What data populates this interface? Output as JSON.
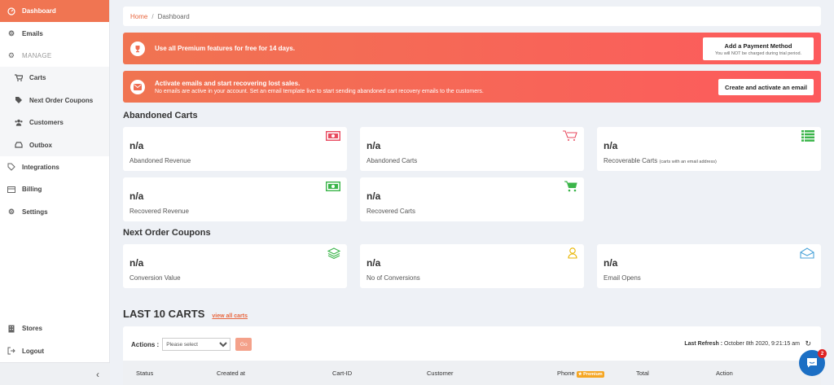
{
  "sidebar": {
    "items": [
      {
        "label": "Dashboard",
        "icon": "dashboard-icon"
      },
      {
        "label": "Emails",
        "icon": "gears-icon"
      },
      {
        "label": "MANAGE",
        "icon": "gear-icon"
      },
      {
        "label": "Carts",
        "icon": "cart-icon"
      },
      {
        "label": "Next Order Coupons",
        "icon": "tags-icon"
      },
      {
        "label": "Customers",
        "icon": "users-icon"
      },
      {
        "label": "Outbox",
        "icon": "inbox-icon"
      },
      {
        "label": "Integrations",
        "icon": "tag-icon"
      },
      {
        "label": "Billing",
        "icon": "credit-card-icon"
      },
      {
        "label": "Settings",
        "icon": "gear-icon"
      }
    ],
    "bottom": [
      {
        "label": "Stores",
        "icon": "building-icon"
      },
      {
        "label": "Logout",
        "icon": "logout-icon"
      }
    ],
    "collapse_glyph": "‹"
  },
  "breadcrumb": {
    "home": "Home",
    "separator": "/",
    "current": "Dashboard"
  },
  "banners": {
    "premium": {
      "title": "Use all Premium features for free for 14 days.",
      "button": "Add a Payment Method",
      "button_sub": "You will NOT be charged during trial period."
    },
    "emails": {
      "title": "Activate emails and start recovering lost sales.",
      "subtitle": "No emails are active in your account. Set an email template live to start sending abandoned cart recovery emails to the customers.",
      "button": "Create and activate an email"
    }
  },
  "abandoned": {
    "title": "Abandoned Carts",
    "cards": [
      {
        "value": "n/a",
        "label": "Abandoned Revenue",
        "icon": "money-icon",
        "color": "#e84a5f"
      },
      {
        "value": "n/a",
        "label": "Abandoned Carts",
        "icon": "cart-icon",
        "color": "#e84a5f"
      },
      {
        "value": "n/a",
        "label": "Recoverable Carts",
        "label_small": "(carts with an email address)",
        "icon": "list-icon",
        "color": "#3bb54a"
      },
      {
        "value": "n/a",
        "label": "Recovered Revenue",
        "icon": "money-icon",
        "color": "#3bb54a"
      },
      {
        "value": "n/a",
        "label": "Recovered Carts",
        "icon": "cart-icon",
        "color": "#3bb54a"
      }
    ]
  },
  "coupons": {
    "title": "Next Order Coupons",
    "cards": [
      {
        "value": "n/a",
        "label": "Conversion Value",
        "icon": "layers-icon",
        "color": "#3bb54a"
      },
      {
        "value": "n/a",
        "label": "No of Conversions",
        "icon": "user-icon",
        "color": "#e8b500"
      },
      {
        "value": "n/a",
        "label": "Email Opens",
        "icon": "envelope-open-icon",
        "color": "#4ba3d8"
      }
    ]
  },
  "last_carts": {
    "title": "LAST 10 CARTS",
    "link": "view all carts",
    "actions_label": "Actions :",
    "select_value": "Please select",
    "go": "Go",
    "refresh_label": "Last Refresh :",
    "refresh_value": "October 8th 2020, 9:21:15 am",
    "columns": [
      "Status",
      "Created at",
      "Cart-ID",
      "Customer",
      "Phone",
      "Total",
      "Action"
    ],
    "premium_badge": "Premium"
  },
  "chat": {
    "badge": "2"
  }
}
